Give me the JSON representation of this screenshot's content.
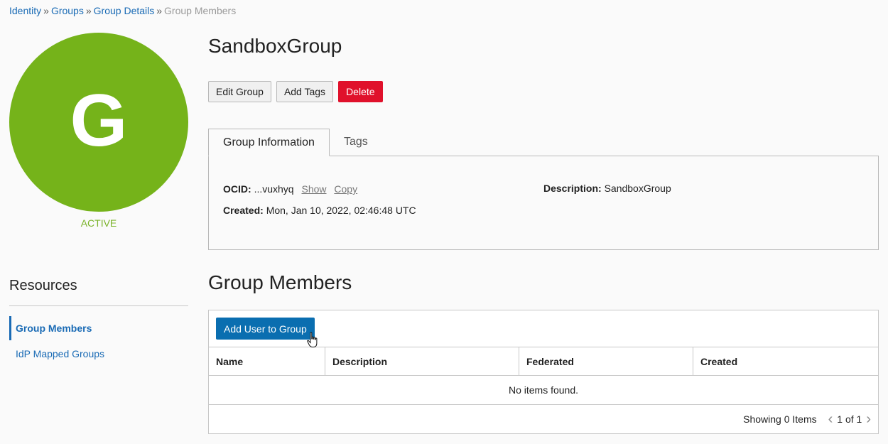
{
  "breadcrumb": {
    "items": [
      "Identity",
      "Groups",
      "Group Details"
    ],
    "separator": "»",
    "current": "Group Members"
  },
  "avatar": {
    "letter": "G",
    "color": "#75b31a"
  },
  "status": "ACTIVE",
  "title": "SandboxGroup",
  "actions": {
    "edit": "Edit Group",
    "tags": "Add Tags",
    "delete": "Delete"
  },
  "tabs": [
    {
      "label": "Group Information",
      "active": true
    },
    {
      "label": "Tags",
      "active": false
    }
  ],
  "info": {
    "ocid_label": "OCID:",
    "ocid_value": "...vuxhyq",
    "show": "Show",
    "copy": "Copy",
    "created_label": "Created:",
    "created_value": "Mon, Jan 10, 2022, 02:46:48 UTC",
    "description_label": "Description:",
    "description_value": "SandboxGroup"
  },
  "resources": {
    "title": "Resources",
    "items": [
      {
        "label": "Group Members",
        "active": true
      },
      {
        "label": "IdP Mapped Groups",
        "active": false
      }
    ]
  },
  "members": {
    "title": "Group Members",
    "add_button": "Add User to Group",
    "columns": [
      "Name",
      "Description",
      "Federated",
      "Created"
    ],
    "empty_message": "No items found.",
    "showing": "Showing 0 Items",
    "page": "1 of 1"
  },
  "colors": {
    "accent": "#0a6eb0",
    "danger": "#e0112b",
    "link": "#1a6bb5",
    "status": "#7ab32a"
  }
}
